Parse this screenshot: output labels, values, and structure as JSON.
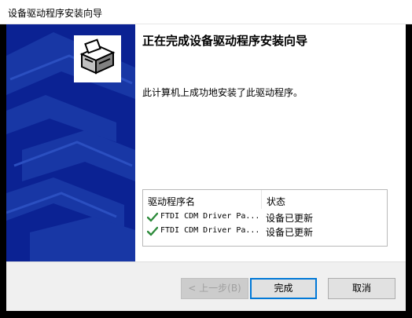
{
  "window": {
    "title": "设备驱动程序安装向导"
  },
  "wizard": {
    "heading": "正在完成设备驱动程序安装向导",
    "message": "此计算机上成功地安装了此驱动程序。"
  },
  "driver_list": {
    "columns": [
      "驱动程序名",
      "状态"
    ],
    "rows": [
      {
        "name": "FTDI CDM Driver Pa...",
        "status": "设备已更新",
        "icon": "green-check-icon"
      },
      {
        "name": "FTDI CDM Driver Pa...",
        "status": "设备已更新",
        "icon": "green-check-icon"
      }
    ]
  },
  "buttons": {
    "back": "< 上一步(B)",
    "finish": "完成",
    "cancel": "取消"
  },
  "colors": {
    "sidebar": "#0b2293",
    "check": "#2e8b3c",
    "focus_border": "#0078d7"
  }
}
